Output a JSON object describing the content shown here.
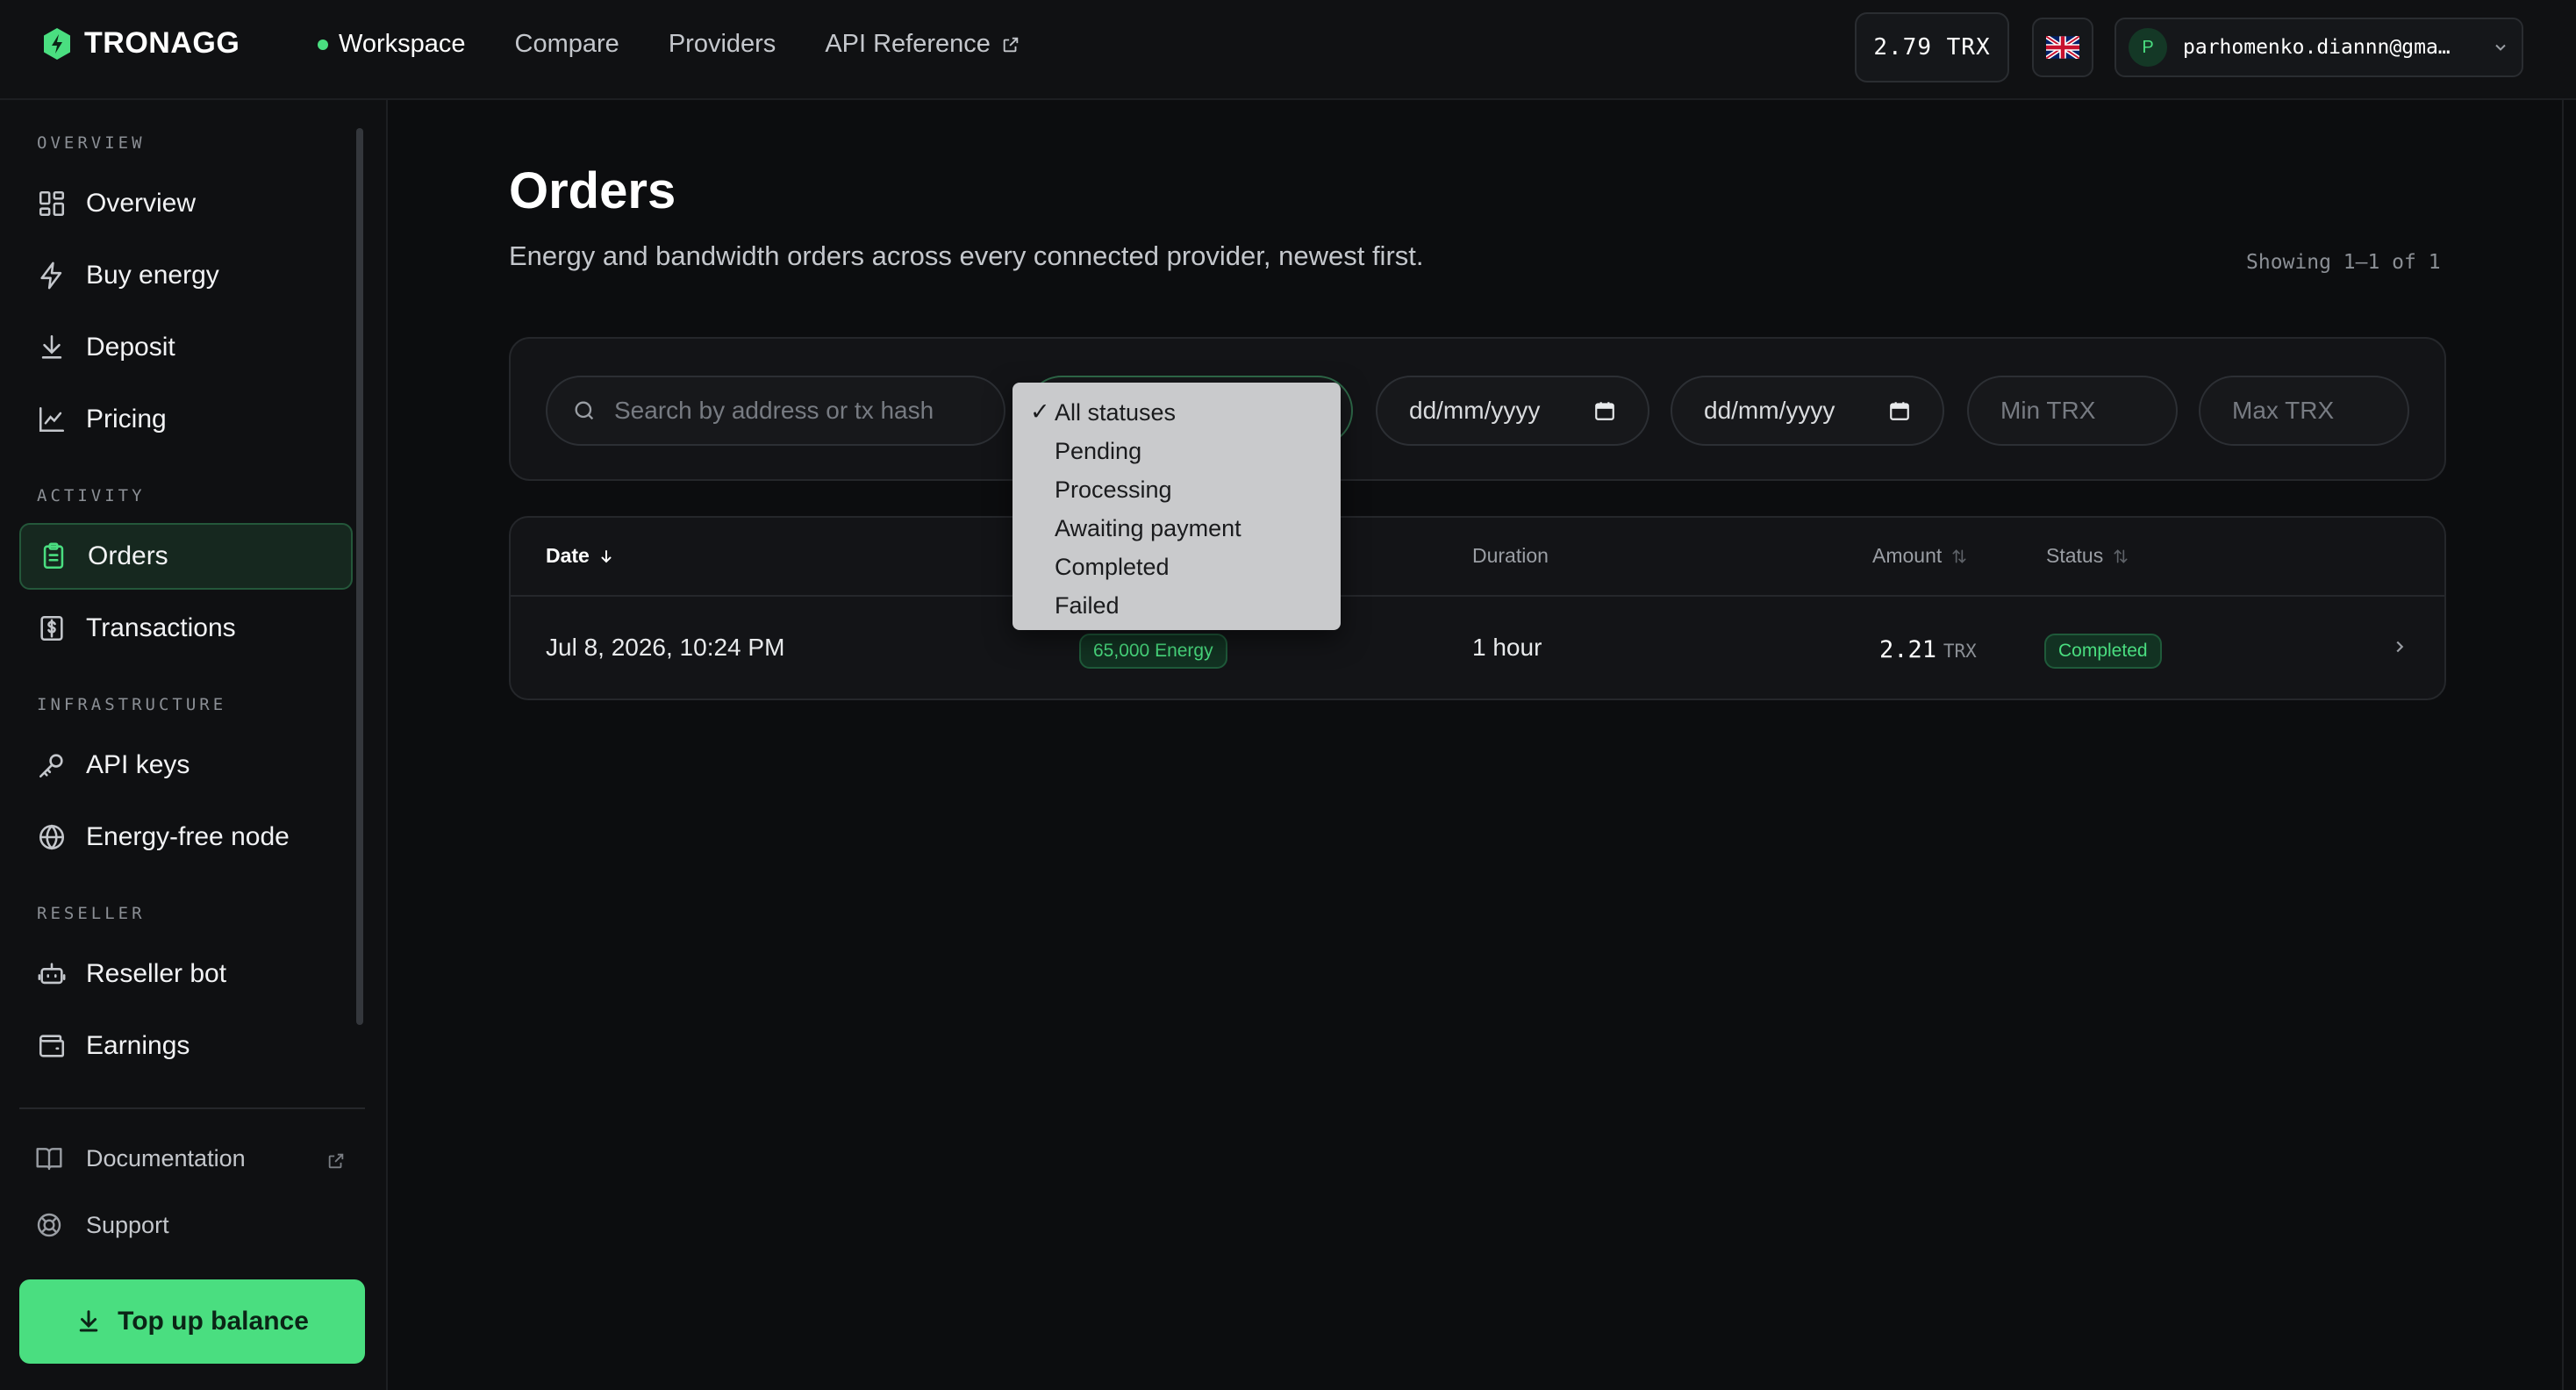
{
  "brand": {
    "name": "TRONAGG"
  },
  "topnav": {
    "workspace": "Workspace",
    "compare": "Compare",
    "providers": "Providers",
    "api_reference": "API Reference"
  },
  "balance": "2.79 TRX",
  "account": {
    "initial": "P",
    "email": "parhomenko.diannn@gma…"
  },
  "sidebar": {
    "overview_section": "OVERVIEW",
    "overview": "Overview",
    "buy_energy": "Buy energy",
    "deposit": "Deposit",
    "pricing": "Pricing",
    "activity_section": "ACTIVITY",
    "orders": "Orders",
    "transactions": "Transactions",
    "infrastructure_section": "INFRASTRUCTURE",
    "api_keys": "API keys",
    "energy_free_node": "Energy-free node",
    "reseller_section": "RESELLER",
    "reseller_bot": "Reseller bot",
    "earnings": "Earnings",
    "documentation": "Documentation",
    "support": "Support",
    "top_up": "Top up balance"
  },
  "page": {
    "title": "Orders",
    "subtitle": "Energy and bandwidth orders across every connected provider, newest first.",
    "showing": "Showing 1–1 of 1"
  },
  "filters": {
    "search_placeholder": "Search by address or tx hash",
    "date_from": "dd/mm/yyyy",
    "date_to": "dd/mm/yyyy",
    "min_placeholder": "Min TRX",
    "max_placeholder": "Max TRX"
  },
  "status_options": {
    "all": "All statuses",
    "pending": "Pending",
    "processing": "Processing",
    "awaiting": "Awaiting payment",
    "completed": "Completed",
    "failed": "Failed"
  },
  "table": {
    "headers": {
      "date": "Date",
      "duration": "Duration",
      "amount": "Amount",
      "status": "Status"
    },
    "rows": [
      {
        "date": "Jul 8, 2026, 10:24 PM",
        "resource": "65,000 Energy",
        "duration": "1 hour",
        "amount": "2.21",
        "unit": "TRX",
        "status": "Completed"
      }
    ]
  },
  "colors": {
    "accent": "#4ade80",
    "background": "#0c0d0f",
    "panel": "#131417"
  }
}
